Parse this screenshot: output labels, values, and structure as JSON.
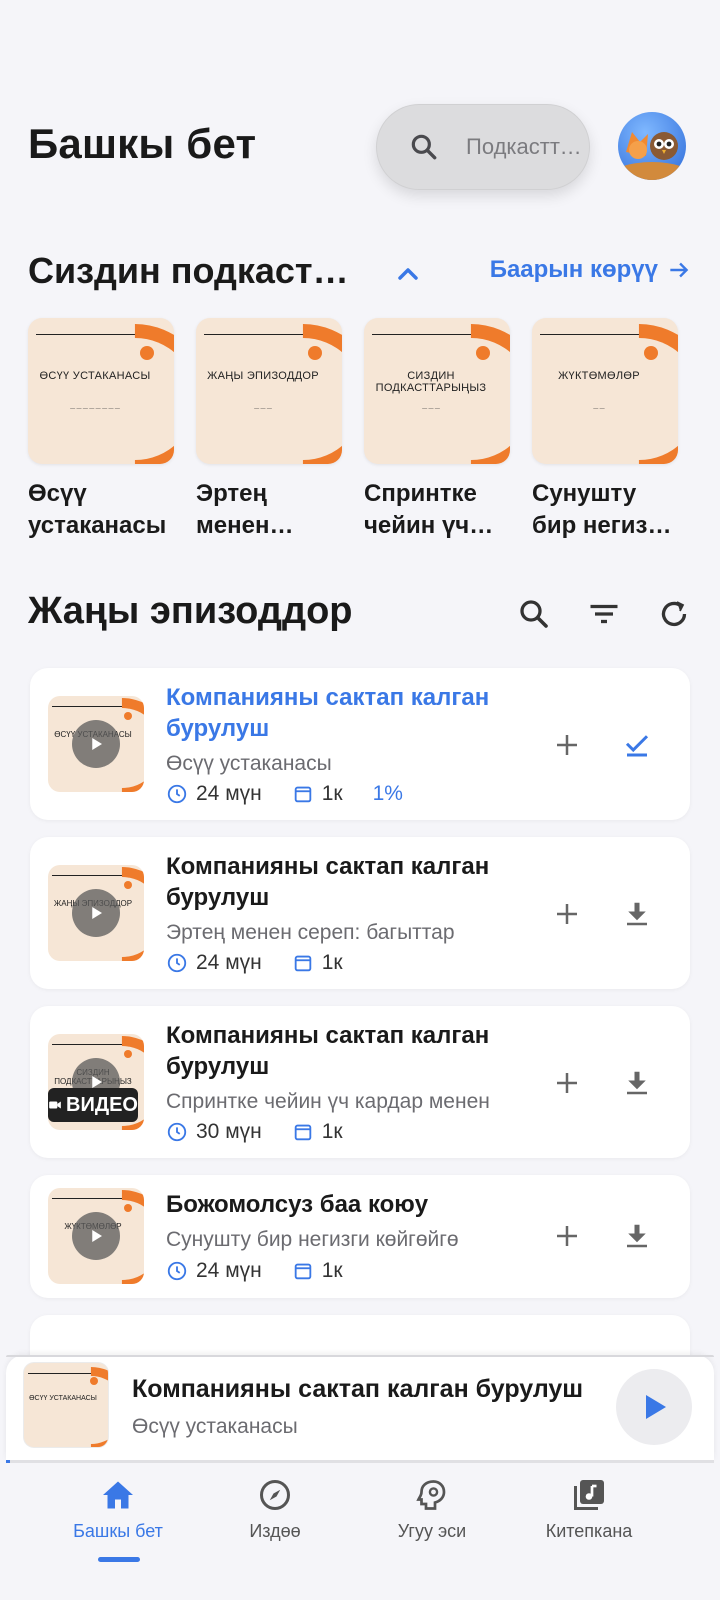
{
  "header": {
    "title": "Башкы бет",
    "search_placeholder": "Подкасттарды издөө"
  },
  "podcasts_section": {
    "title": "Сиздин подкасттарыңыз",
    "see_all": "Баарын көрүү",
    "items": [
      {
        "name": "Өсүү устаканасы",
        "cover_title": "ӨСҮҮ УСТАКАНАСЫ"
      },
      {
        "name": "Эртең менен сереп: багыттар",
        "cover_title": "ЖАҢЫ ЭПИЗОДДОР"
      },
      {
        "name": "Спринтке чейин үч кардар",
        "cover_title": "СИЗДИН ПОДКАСТТАРЫҢЫЗ"
      },
      {
        "name": "Сунушту бир негизги көйгөйгө",
        "cover_title": "ЖҮКТӨМӨЛӨР"
      }
    ]
  },
  "episodes_section": {
    "title": "Жаңы эпизоддор",
    "items": [
      {
        "title": "Компанияны сактап калган бурулуш",
        "podcast": "Өсүү устаканасы",
        "duration": "24 мүн",
        "date": "1к",
        "progress": "1%",
        "cover_title": "ӨСҮҮ УСТАКАНАСЫ",
        "video": false
      },
      {
        "title": "Компанияны сактап калган бурулуш",
        "podcast": "Эртең менен сереп: багыттар",
        "duration": "24 мүн",
        "date": "1к",
        "progress": "",
        "cover_title": "ЖАҢЫ ЭПИЗОДДОР",
        "video": false
      },
      {
        "title": "Компанияны сактап калган бурулуш",
        "podcast": "Спринтке чейин үч кардар менен",
        "duration": "30 мүн",
        "date": "1к",
        "progress": "",
        "cover_title": "СИЗДИН ПОДКАСТТАРЫҢЫЗ",
        "video": true,
        "video_label": "ВИДЕО"
      },
      {
        "title": "Божомолсуз баа коюу",
        "podcast": "Сунушту бир негизги көйгөйгө",
        "duration": "24 мүн",
        "date": "1к",
        "progress": "",
        "cover_title": "ЖҮКТӨМӨЛӨР",
        "video": false
      }
    ]
  },
  "mini_player": {
    "title": "Компанияны сактап калган бурулуш",
    "podcast": "Өсүү устаканасы",
    "cover_title": "ӨСҮҮ УСТАКАНАСЫ",
    "progress_percent": 1
  },
  "bottom_nav": {
    "items": [
      {
        "label": "Башкы бет",
        "icon": "home-icon",
        "active": true
      },
      {
        "label": "Издөө",
        "icon": "compass-icon",
        "active": false
      },
      {
        "label": "Угуу эси",
        "icon": "brain-icon",
        "active": false
      },
      {
        "label": "Китепкана",
        "icon": "library-icon",
        "active": false
      }
    ]
  },
  "colors": {
    "accent": "#3a78e6",
    "cover_bg": "#f6e6d6",
    "cover_orange": "#ef7b2b"
  }
}
